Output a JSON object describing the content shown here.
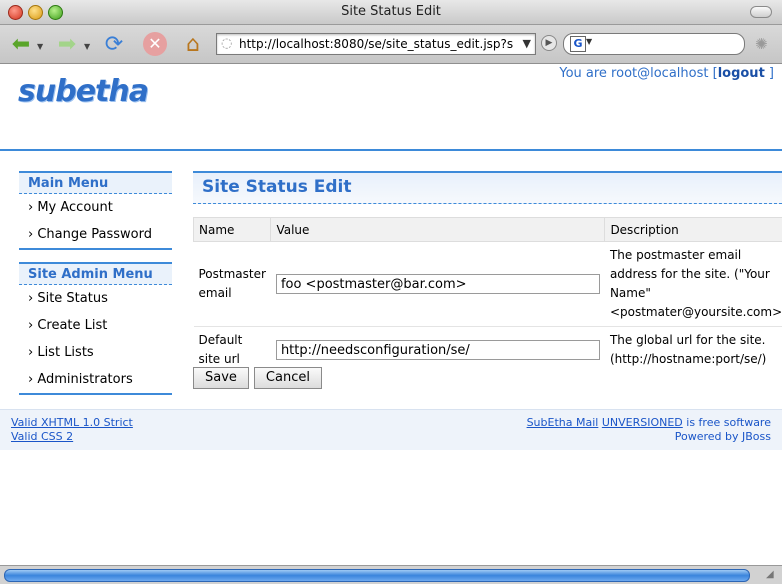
{
  "window": {
    "title": "Site Status Edit"
  },
  "toolbar": {
    "url": "http://localhost:8080/se/site_status_edit.jsp?s",
    "search_icon": "G"
  },
  "header": {
    "logo": "subetha",
    "user_prefix": "You are root@localhost [",
    "logout": "logout",
    "user_suffix": " ]"
  },
  "sidebar": {
    "main_menu": {
      "title": "Main Menu",
      "items": [
        {
          "label": "› My Account"
        },
        {
          "label": "› Change Password"
        }
      ]
    },
    "admin_menu": {
      "title": "Site Admin Menu",
      "items": [
        {
          "label": "› Site Status"
        },
        {
          "label": "› Create List"
        },
        {
          "label": "› List Lists"
        },
        {
          "label": "› Administrators"
        }
      ]
    }
  },
  "main": {
    "title": "Site Status Edit",
    "table": {
      "headers": [
        "Name",
        "Value",
        "Description"
      ],
      "rows": [
        {
          "name": "Postmaster email",
          "value": "foo <postmaster@bar.com>",
          "description": "The postmaster email address for the site. (\"Your Name\" <postmater@yoursite.com>)"
        },
        {
          "name": "Default site url",
          "value": "http://needsconfiguration/se/",
          "description": "The global url for the site. (http://hostname:port/se/)"
        }
      ]
    },
    "buttons": {
      "save": "Save",
      "cancel": "Cancel"
    }
  },
  "footer": {
    "xhtml": "Valid XHTML 1.0 Strict",
    "css": "Valid CSS 2",
    "product": "SubEtha Mail",
    "version": "UNVERSIONED",
    "free": " is free software",
    "powered_prefix": "Powered by ",
    "jboss": "JBoss"
  }
}
